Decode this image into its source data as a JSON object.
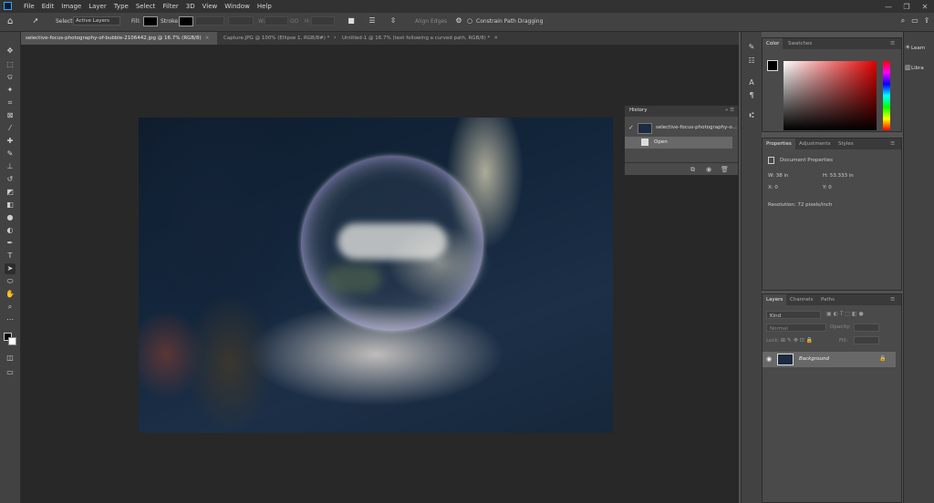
{
  "app": {
    "logo": "Ps"
  },
  "menubar": {
    "items": [
      "File",
      "Edit",
      "Image",
      "Layer",
      "Type",
      "Select",
      "Filter",
      "3D",
      "View",
      "Window",
      "Help"
    ],
    "window_controls": [
      "—",
      "❐",
      "✕"
    ]
  },
  "options": {
    "select_label": "Select:",
    "select_value": "Active Layers",
    "fill_label": "Fill:",
    "stroke_label": "Stroke:",
    "w_label": "W:",
    "h_label": "H:",
    "go_label": "GO",
    "align_edges": "Align Edges",
    "constrain": "Constrain Path Dragging"
  },
  "tabs": [
    {
      "label": "selective-focus-photography-of-bubble-2106442.jpg @ 16.7% (RGB/8)",
      "active": true
    },
    {
      "label": "Capture.JPG @ 100% (Ellipse 1, RGB/8#) *",
      "active": false
    },
    {
      "label": "Untitled-1 @ 16.7% (text following a curved path, RGB/8) *",
      "active": false
    }
  ],
  "history": {
    "title": "History",
    "snapshot": "selective-focus-photography-o...",
    "step": "Open"
  },
  "color_panel": {
    "tabs": [
      "Color",
      "Swatches"
    ],
    "accent": "#e00000"
  },
  "properties": {
    "tabs": [
      "Properties",
      "Adjustments",
      "Styles"
    ],
    "header": "Document Properties",
    "w": "W: 38 in",
    "h": "H: 53.333 in",
    "x": "X: 0",
    "y": "Y: 0",
    "resolution": "Resolution: 72 pixels/inch"
  },
  "layers": {
    "tabs": [
      "Layers",
      "Channels",
      "Paths"
    ],
    "kind": "Kind",
    "blend": "Normal",
    "opacity_label": "Opacity:",
    "lock_label": "Lock:",
    "fill_label": "Fill:",
    "layer_name": "Background"
  },
  "far_right": {
    "learn": "Learn",
    "libraries": "Libra"
  }
}
